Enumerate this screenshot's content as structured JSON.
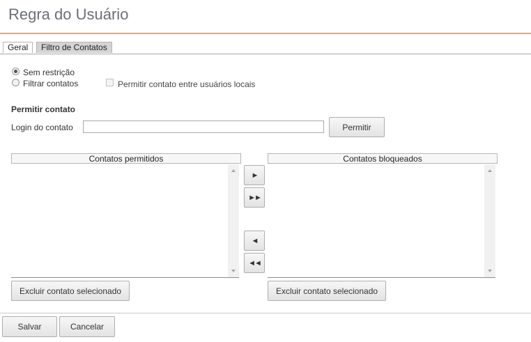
{
  "page": {
    "title": "Regra do Usuário"
  },
  "tabs": [
    {
      "label": "Geral",
      "active": false
    },
    {
      "label": "Filtro de Contatos",
      "active": true
    }
  ],
  "restriction": {
    "options": [
      {
        "label": "Sem restrição",
        "checked": true
      },
      {
        "label": "Filtrar contatos",
        "checked": false
      }
    ],
    "local_contacts_checkbox": {
      "label": "Permitir contato entre usuários locais",
      "checked": false
    }
  },
  "permit": {
    "section_title": "Permitir contato",
    "login_label": "Login do contato",
    "login_value": "",
    "permit_button": "Permitir"
  },
  "lists": {
    "allowed": {
      "header": "Contatos permitidos",
      "items": [],
      "delete_button": "Excluir contato selecionado"
    },
    "blocked": {
      "header": "Contatos bloqueados",
      "items": [],
      "delete_button": "Excluir contato selecionado"
    }
  },
  "move_buttons": {
    "right_one": "►",
    "right_all": "►►",
    "left_one": "◄",
    "left_all": "◄◄"
  },
  "footer": {
    "save": "Salvar",
    "cancel": "Cancelar"
  },
  "colors": {
    "accent_line": "#f3a259",
    "title_text": "#6b6f75",
    "active_tab": "#d4d4d4"
  }
}
